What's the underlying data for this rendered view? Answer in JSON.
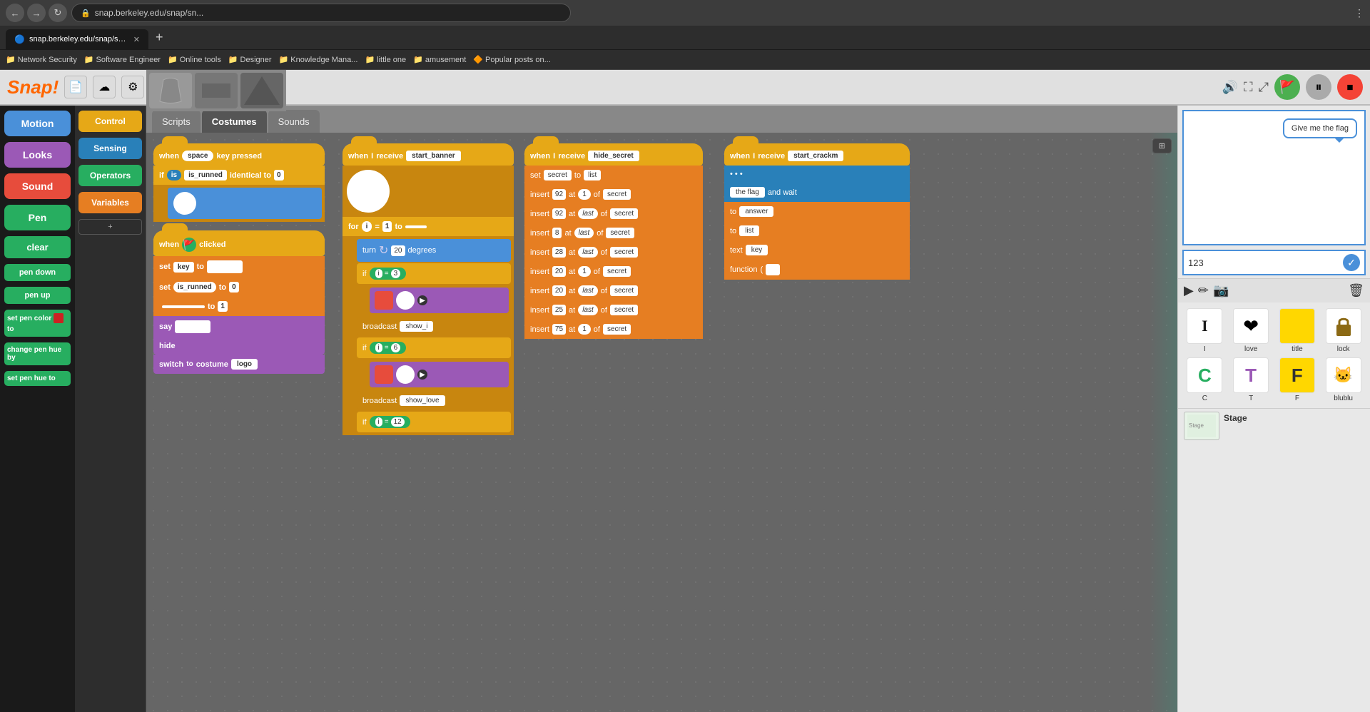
{
  "browser": {
    "url": "snap.berkeley.edu/snap/sn...",
    "tabs": [
      {
        "label": "snap.berkeley.edu/snap/sn...",
        "active": true
      },
      {
        "label": "...",
        "active": false
      }
    ],
    "bookmarks": [
      {
        "label": "Network Security",
        "icon": "📁"
      },
      {
        "label": "Software Engineer",
        "icon": "📁"
      },
      {
        "label": "Online tools",
        "icon": "📁"
      },
      {
        "label": "Designer",
        "icon": "📁"
      },
      {
        "label": "Knowledge Mana...",
        "icon": "📁"
      },
      {
        "label": "little one",
        "icon": "📁"
      },
      {
        "label": "amusement",
        "icon": "📁"
      },
      {
        "label": "Popular posts on...",
        "icon": "🔶"
      }
    ]
  },
  "snap": {
    "logo": "Snap!",
    "toolbar": {
      "cloud_label": "☁",
      "settings_label": "⚙",
      "fullscreen_label": "⛶",
      "flag_label": "🚩",
      "pause_label": "⏸",
      "stop_label": "🔴"
    },
    "categories": [
      {
        "label": "Motion",
        "color": "#4a90d9"
      },
      {
        "label": "Looks",
        "color": "#9b59b6"
      },
      {
        "label": "Sound",
        "color": "#e74c3c"
      },
      {
        "label": "Pen",
        "color": "#27ae60"
      },
      {
        "label": "clear",
        "color": "#27ae60"
      },
      {
        "label": "pen down",
        "color": "#27ae60"
      },
      {
        "label": "pen up",
        "color": "#27ae60"
      },
      {
        "label": "set pen color to",
        "color": "#27ae60"
      },
      {
        "label": "change pen hue by",
        "color": "#27ae60"
      },
      {
        "label": "set pen hue to",
        "color": "#27ae60"
      }
    ],
    "palette_categories": [
      {
        "label": "Control",
        "color": "#e6a817"
      },
      {
        "label": "Sensing",
        "color": "#2980b9"
      },
      {
        "label": "Operators",
        "color": "#27ae60"
      },
      {
        "label": "Variables",
        "color": "#e67e22"
      }
    ],
    "tabs": [
      {
        "label": "Scripts",
        "active": false
      },
      {
        "label": "Costumes",
        "active": true
      },
      {
        "label": "Sounds",
        "active": false
      }
    ],
    "stage": {
      "speech_bubble": "Give me the flag",
      "answer_input": "123",
      "answer_check": "✓",
      "label": "Stage"
    },
    "sprites": [
      {
        "label": "I",
        "icon": "I",
        "color": "#1a1a1a"
      },
      {
        "label": "love",
        "icon": "❤",
        "color": "#e74c3c"
      },
      {
        "label": "title",
        "icon": "🟨",
        "color": "#ffd700"
      },
      {
        "label": "lock",
        "icon": "🔒",
        "color": "#333"
      },
      {
        "label": "C",
        "icon": "C",
        "color": "#27ae60"
      },
      {
        "label": "T",
        "icon": "T",
        "color": "#9b59b6"
      },
      {
        "label": "F",
        "icon": "F",
        "color": "#ffd700"
      },
      {
        "label": "blublu",
        "icon": "🐱",
        "color": "#f39c12"
      }
    ],
    "blocks": {
      "when_space_pressed": "when space key pressed",
      "when_clicked": "when clicked",
      "if_is_runned": "if is_runned identical to",
      "set_key": "set key to",
      "set_is_runned": "set is_runned to",
      "say": "say",
      "hide": "hide",
      "switch_costume_logo": "switch to costume logo",
      "when_receive_start": "when I receive start_banner",
      "for_loop": "for i = 1 to",
      "turn_degrees": "turn 20 degrees",
      "if_i_eq_3": "if i = 3",
      "broadcast_show_i": "broadcast show_i",
      "if_i_eq_6": "if i = 6",
      "broadcast_show_love": "broadcast show_love",
      "if_i_eq_12": "if i = 12",
      "when_receive_hide": "when I receive hide_secret",
      "set_secret": "set secret to list",
      "insert_92_1": "insert 92 at 1 of secret",
      "insert_92_last": "insert 92 at last of secret",
      "insert_8_last": "insert 8 at last of secret",
      "insert_28_last": "insert 28 at last of secret",
      "insert_20_1": "insert 20 at 1 of secret",
      "insert_20_last_2": "insert 20 at last of secret",
      "insert_25_last": "insert 25 at last of secret",
      "insert_75_1": "insert 75 at 1 of secret",
      "when_receive_crackm": "when I receive start_crackm",
      "the_flag": "the flag",
      "and_wait": "and wait",
      "to_answer": "to answer",
      "to_list": "to list",
      "text_key": "text key",
      "function_open": "function (",
      "val_1": "1"
    }
  }
}
